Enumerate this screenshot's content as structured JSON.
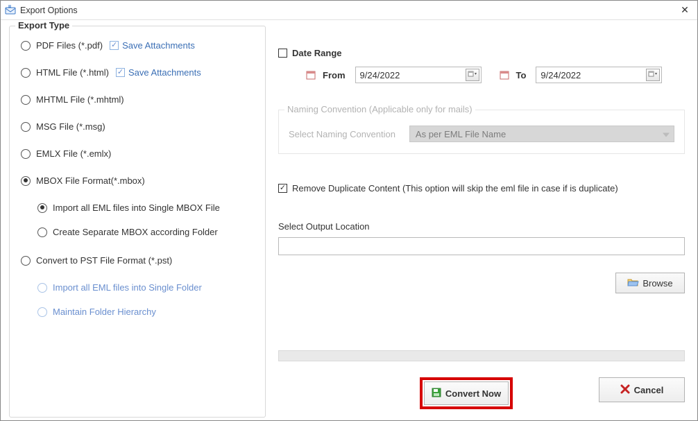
{
  "titlebar": {
    "title": "Export Options",
    "close": "✕"
  },
  "left": {
    "legend": "Export Type",
    "options": {
      "pdf": {
        "label": "PDF Files (*.pdf)",
        "save_attach": "Save Attachments"
      },
      "html": {
        "label": "HTML File  (*.html)",
        "save_attach": "Save Attachments"
      },
      "mhtml": {
        "label": "MHTML File  (*.mhtml)"
      },
      "msg": {
        "label": "MSG File (*.msg)"
      },
      "emlx": {
        "label": "EMLX File (*.emlx)"
      },
      "mbox": {
        "label": "MBOX File Format(*.mbox)",
        "sub": {
          "single": "Import all EML files into Single MBOX File",
          "separate": "Create Separate MBOX according Folder"
        }
      },
      "pst": {
        "label": "Convert to PST File Format (*.pst)",
        "sub": {
          "single": "Import all EML files into Single Folder",
          "maintain": "Maintain Folder Hierarchy"
        }
      }
    }
  },
  "right": {
    "date_range": {
      "title": "Date Range",
      "from_label": "From",
      "to_label": "To",
      "from_value": "9/24/2022",
      "to_value": "9/24/2022"
    },
    "naming": {
      "legend": "Naming Convention (Applicable only for mails)",
      "label": "Select Naming Convention",
      "value": "As per EML File Name"
    },
    "remove_dup": "Remove Duplicate Content (This option will skip the eml file in case if is duplicate)",
    "output_label": "Select Output Location",
    "output_value": "",
    "browse": "Browse",
    "convert": "Convert Now",
    "cancel": "Cancel"
  }
}
